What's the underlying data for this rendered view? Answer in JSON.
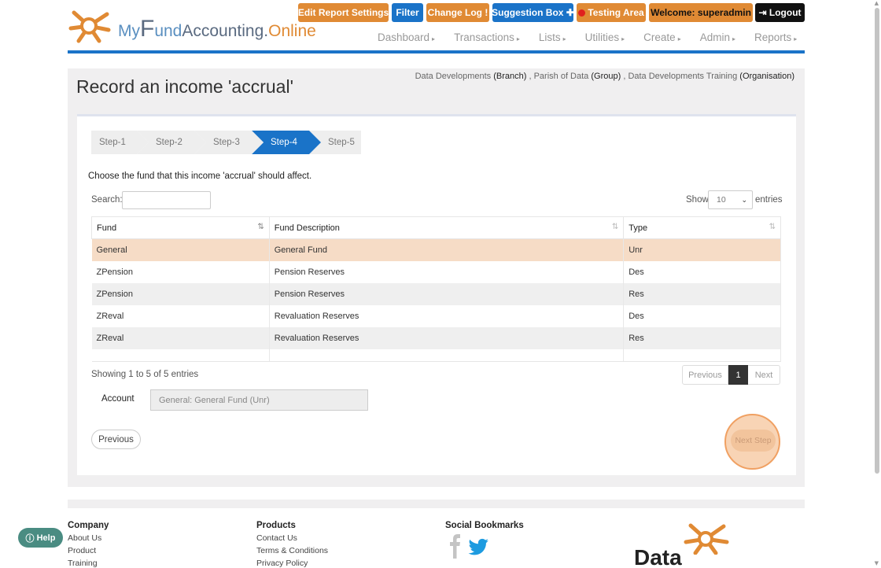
{
  "logo": {
    "part1": "My",
    "part2": "F",
    "part3": "und",
    "part4": "Accounting.",
    "part5": "Online"
  },
  "topbar": {
    "edit_report": "Edit Report Settings",
    "filter": "Filter",
    "change_log": "Change Log",
    "change_log_mark": "!",
    "suggestion": "Suggestion Box",
    "suggestion_mark": "✚",
    "testing": "Testing Area",
    "welcome": "Welcome:  superadmin",
    "logout": "Logout"
  },
  "nav": [
    "Dashboard",
    "Transactions",
    "Lists",
    "Utilities",
    "Create",
    "Admin",
    "Reports"
  ],
  "page": {
    "title": "Record an income 'accrual'",
    "org": {
      "branch_name": "Data Developments",
      "branch_tag": "(Branch)",
      "group_name": "Parish of Data",
      "group_tag": "(Group)",
      "org_name": "Data Developments Training",
      "org_tag": "(Organisation)"
    }
  },
  "steps": [
    "Step-1",
    "Step-2",
    "Step-3",
    "Step-4",
    "Step-5"
  ],
  "prompt": "Choose the fund that this income 'accrual' should affect.",
  "search": {
    "label": "Search:",
    "value": ""
  },
  "length": {
    "show": "Show",
    "value": "10",
    "entries": "entries"
  },
  "table": {
    "headers": [
      "Fund",
      "Fund Description",
      "Type"
    ],
    "rows": [
      [
        "General",
        "General Fund",
        "Unr"
      ],
      [
        "ZPension",
        "Pension Reserves",
        "Des"
      ],
      [
        "ZPension",
        "Pension Reserves",
        "Res"
      ],
      [
        "ZReval",
        "Revaluation Reserves",
        "Des"
      ],
      [
        "ZReval",
        "Revaluation Reserves",
        "Res"
      ]
    ]
  },
  "info": "Showing 1 to 5 of 5 entries",
  "pager": {
    "prev": "Previous",
    "current": "1",
    "next": "Next"
  },
  "account": {
    "label": "Account",
    "value": "General: General Fund (Unr)"
  },
  "buttons": {
    "previous": "Previous",
    "next_step": "Next Step"
  },
  "footer": {
    "company": {
      "title": "Company",
      "links": [
        "About Us",
        "Product",
        "Training"
      ]
    },
    "products": {
      "title": "Products",
      "links": [
        "Contact Us",
        "Terms & Conditions",
        "Privacy Policy"
      ]
    },
    "social": {
      "title": "Social Bookmarks"
    },
    "brand": "Data"
  },
  "help": "Help",
  "colors": {
    "accent_orange": "#e08a34",
    "accent_blue": "#1a73c8",
    "selected_row": "#f6dcc6"
  }
}
